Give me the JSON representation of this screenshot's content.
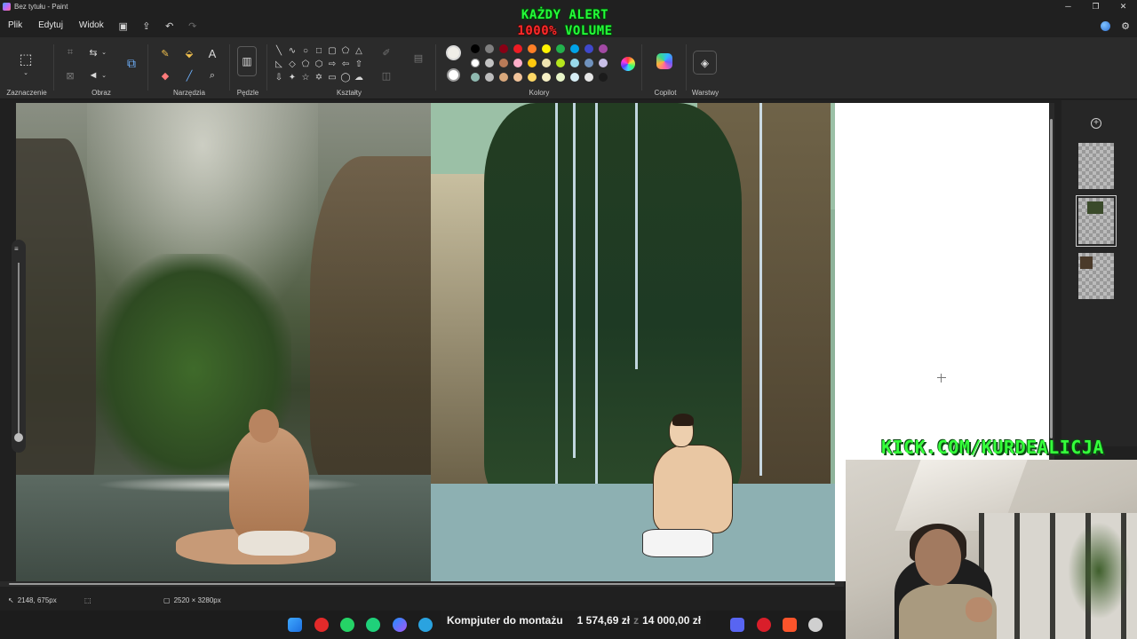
{
  "window": {
    "title": "Bez tytułu - Paint"
  },
  "overlay": {
    "alert_line1": "KAŻDY ALERT",
    "alert_pct": "1000%",
    "alert_word": "VOLUME",
    "kick": "KICK.COM/KURDEALICJA"
  },
  "menu": {
    "file": "Plik",
    "edit": "Edytuj",
    "view": "Widok"
  },
  "ribbon": {
    "selection_label": "Zaznaczenie",
    "image_label": "Obraz",
    "tools_label": "Narzędzia",
    "brushes_label": "Pędzle",
    "shapes_label": "Kształty",
    "colors_label": "Kolory",
    "copilot_label": "Copilot",
    "layers_label": "Warstwy"
  },
  "colors": {
    "primary": "#f0eee8",
    "secondary": "#ffffff",
    "accent_green": "#23ff38",
    "swatches": [
      "#000000",
      "#7f7f7f",
      "#880015",
      "#ed1c24",
      "#ff7f27",
      "#fff200",
      "#22b14c",
      "#00a2e8",
      "#3f48cc",
      "#a349a4",
      "#ffffff",
      "#c3c3c3",
      "#b97a57",
      "#ffaec9",
      "#ffc90e",
      "#efe4b0",
      "#b5e61d",
      "#99d9ea",
      "#7092be",
      "#c8bfe7",
      "#8fb9b0",
      "#bdbdbd",
      "#d9a87c",
      "#f2c49b",
      "#ffd966",
      "#f7f0c5",
      "#e8f5c8",
      "#d7eef5",
      "#e6e6e6",
      "#1b1b1b"
    ]
  },
  "status": {
    "cursor_pos": "2148, 675px",
    "canvas_size": "2520 × 3280px"
  },
  "ticker": {
    "text": "Kompjuter do montażu",
    "amount1": "1 574,69 zł",
    "amount2": "14 000,00 zł"
  }
}
